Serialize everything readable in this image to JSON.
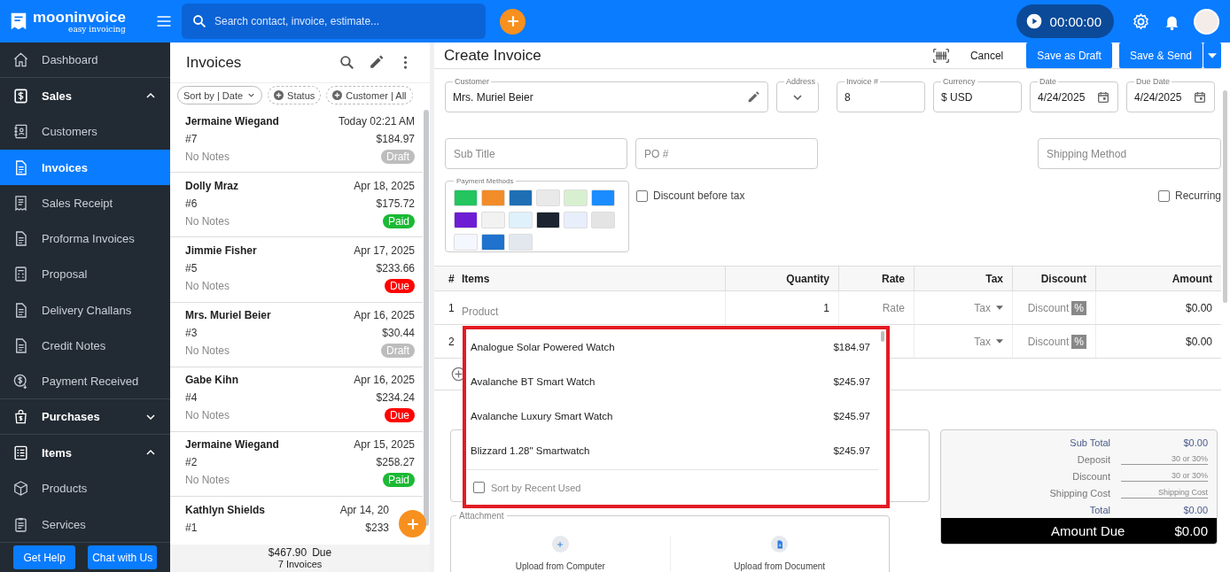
{
  "app": {
    "logo": "mooninvoice",
    "tagline": "easy invoicing",
    "search_placeholder": "Search contact, invoice, estimate...",
    "timer": "00:00:00"
  },
  "sidebar": {
    "items": [
      {
        "label": "Dashboard",
        "kind": "link",
        "selected": false
      },
      {
        "label": "Sales",
        "kind": "section",
        "selected": false,
        "expanded": true
      },
      {
        "label": "Customers",
        "kind": "link",
        "selected": false
      },
      {
        "label": "Invoices",
        "kind": "link",
        "selected": true
      },
      {
        "label": "Sales Receipt",
        "kind": "link",
        "selected": false
      },
      {
        "label": "Proforma Invoices",
        "kind": "link",
        "selected": false
      },
      {
        "label": "Proposal",
        "kind": "link",
        "selected": false
      },
      {
        "label": "Delivery Challans",
        "kind": "link",
        "selected": false
      },
      {
        "label": "Credit Notes",
        "kind": "link",
        "selected": false
      },
      {
        "label": "Payment Received",
        "kind": "link",
        "selected": false
      },
      {
        "label": "Purchases",
        "kind": "section",
        "selected": false,
        "expanded": false
      },
      {
        "label": "Items",
        "kind": "section",
        "selected": false,
        "expanded": true
      },
      {
        "label": "Products",
        "kind": "link",
        "selected": false
      },
      {
        "label": "Services",
        "kind": "link",
        "selected": false
      }
    ],
    "buttons": [
      "Get Help",
      "Chat with Us"
    ]
  },
  "invoice_list": {
    "title": "Invoices",
    "filters": [
      {
        "label": "Sort by | Date",
        "kind": "sort"
      },
      {
        "label": "Status",
        "kind": "add"
      },
      {
        "label": "Customer | All",
        "kind": "add"
      }
    ],
    "invoices": [
      {
        "customer": "Jermaine Wiegand",
        "date": "Today 02:21 AM",
        "number": "#7",
        "amount": "$184.97",
        "notes": "No Notes",
        "status": {
          "label": "Draft",
          "kind": "draft"
        }
      },
      {
        "customer": "Dolly Mraz",
        "date": "Apr 18, 2025",
        "number": "#6",
        "amount": "$175.72",
        "notes": "No Notes",
        "status": {
          "label": "Paid",
          "kind": "paid"
        }
      },
      {
        "customer": "Jimmie Fisher",
        "date": "Apr 17, 2025",
        "number": "#5",
        "amount": "$233.66",
        "notes": "No Notes",
        "status": {
          "label": "Due",
          "kind": "due"
        }
      },
      {
        "customer": "Mrs. Muriel Beier",
        "date": "Apr 16, 2025",
        "number": "#3",
        "amount": "$30.44",
        "notes": "No Notes",
        "status": {
          "label": "Draft",
          "kind": "draft"
        }
      },
      {
        "customer": "Gabe Kihn",
        "date": "Apr 16, 2025",
        "number": "#4",
        "amount": "$234.24",
        "notes": "No Notes",
        "status": {
          "label": "Due",
          "kind": "due"
        }
      },
      {
        "customer": "Jermaine Wiegand",
        "date": "Apr 15, 2025",
        "number": "#2",
        "amount": "$258.27",
        "notes": "No Notes",
        "status": {
          "label": "Paid",
          "kind": "paid"
        }
      },
      {
        "customer": "Kathlyn Shields",
        "date": "Apr 14, 20",
        "number": "#1",
        "amount": "$233"
      }
    ],
    "footer": {
      "total": "$467.90",
      "total_label": "Due",
      "count": "7 Invoices"
    }
  },
  "editor": {
    "title": "Create Invoice",
    "actions": [
      {
        "label": "Cancel",
        "kind": "text"
      },
      {
        "label": "Save as Draft",
        "kind": "primary"
      },
      {
        "label": "Save & Send",
        "kind": "split"
      }
    ],
    "fields": [
      {
        "label": "Customer",
        "value": "Mrs. Muriel Beier",
        "kind": "customer"
      },
      {
        "label": "Address",
        "kind": "select"
      },
      {
        "label": "Invoice #",
        "value": "8",
        "kind": "text"
      },
      {
        "label": "Currency",
        "value": "$ USD",
        "kind": "text"
      },
      {
        "label": "Date",
        "value": "4/24/2025",
        "kind": "date"
      },
      {
        "label": "Due Date",
        "value": "4/24/2025",
        "kind": "date"
      }
    ],
    "extra_fields": [
      {
        "placeholder": "Sub Title"
      },
      {
        "placeholder": "PO #"
      },
      {
        "placeholder": "Shipping Method"
      }
    ],
    "payment_methods": {
      "label": "Payment Methods",
      "methods": [
        {
          "color": "#22c55e"
        },
        {
          "color": "#f28c28"
        },
        {
          "color": "#1f6fb5"
        },
        {
          "color": "#e9e9e9"
        },
        {
          "color": "#d8f0d0"
        },
        {
          "color": "#1a8cff"
        },
        {
          "color": "#6d1ed4"
        },
        {
          "color": "#f2f2f2"
        },
        {
          "color": "#dff1fb"
        },
        {
          "color": "#1b2430"
        },
        {
          "color": "#e8eefc"
        },
        {
          "color": "#e4e4e4"
        },
        {
          "color": "#f5f7ff"
        },
        {
          "color": "#1f72cd"
        },
        {
          "color": "#e3e8ef"
        }
      ]
    },
    "options": [
      {
        "label": "Discount before tax",
        "checked": false
      },
      {
        "label": "Recurring",
        "checked": false
      }
    ],
    "table": {
      "columns": [
        "#",
        "Items",
        "Quantity",
        "Rate",
        "Tax",
        "Discount",
        "Amount"
      ],
      "rows": [
        {
          "number": "1",
          "item_placeholder": "Product",
          "quantity": "1",
          "rate_placeholder": "Rate",
          "tax": "Tax",
          "discount_placeholder": "Discount",
          "discount_unit": "%",
          "amount": "$0.00"
        },
        {
          "number": "2",
          "tax": "Tax",
          "discount_placeholder": "Discount",
          "discount_unit": "%",
          "amount": "$0.00"
        }
      ]
    },
    "totals": {
      "rows": [
        {
          "label": "Sub Total",
          "value": "$0.00",
          "kind": "value"
        },
        {
          "label": "Deposit",
          "placeholder": "30 or 30%",
          "kind": "input"
        },
        {
          "label": "Discount",
          "placeholder": "30 or 30%",
          "kind": "input"
        },
        {
          "label": "Shipping Cost",
          "placeholder": "Shipping Cost",
          "kind": "input"
        },
        {
          "label": "Total",
          "value": "$0.00",
          "kind": "value"
        }
      ],
      "amount_due": {
        "label": "Amount Due",
        "value": "$0.00"
      }
    },
    "attachment": {
      "legend": "Attachment",
      "options": [
        {
          "label": "Upload from Computer",
          "kind": "computer"
        },
        {
          "label": "Upload from Document",
          "kind": "document"
        }
      ]
    },
    "product_dropdown": {
      "products": [
        {
          "name": "Analogue Solar Powered Watch",
          "price": "$184.97"
        },
        {
          "name": "Avalanche BT Smart Watch",
          "price": "$245.97"
        },
        {
          "name": "Avalanche Luxury Smart Watch",
          "price": "$245.97"
        },
        {
          "name": "Blizzard 1.28\" Smartwatch",
          "price": "$245.97"
        }
      ],
      "sort_option": {
        "label": "Sort by Recent Used",
        "checked": false
      }
    }
  }
}
